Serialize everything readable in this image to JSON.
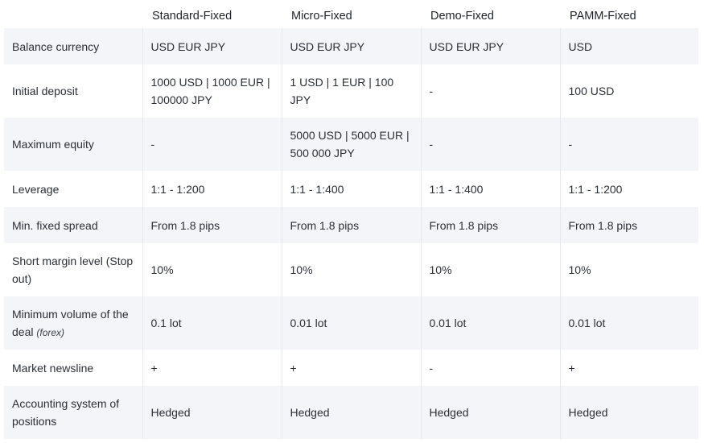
{
  "columns": [
    "",
    "Standard-Fixed",
    "Micro-Fixed",
    "Demo-Fixed",
    "PAMM-Fixed"
  ],
  "rows": [
    {
      "label": "Balance currency",
      "note": "",
      "values": [
        "USD EUR JPY",
        "USD EUR JPY",
        "USD EUR JPY",
        "USD"
      ]
    },
    {
      "label": "Initial deposit",
      "note": "",
      "values": [
        "1000 USD | 1000 EUR | 100000 JPY",
        "1 USD | 1 EUR | 100 JPY",
        "-",
        "100 USD"
      ]
    },
    {
      "label": "Maximum equity",
      "note": "",
      "values": [
        "-",
        "5000 USD | 5000 EUR | 500 000 JPY",
        "-",
        "-"
      ]
    },
    {
      "label": "Leverage",
      "note": "",
      "values": [
        "1:1 - 1:200",
        "1:1 - 1:400",
        "1:1 - 1:400",
        "1:1 - 1:200"
      ]
    },
    {
      "label": "Min. fixed spread",
      "note": "",
      "values": [
        "From 1.8 pips",
        "From 1.8 pips",
        "From 1.8 pips",
        "From 1.8 pips"
      ]
    },
    {
      "label": "Short margin level (Stop out)",
      "note": "",
      "values": [
        "10%",
        "10%",
        "10%",
        "10%"
      ]
    },
    {
      "label": "Minimum volume of the deal",
      "note": "(forex)",
      "values": [
        "0.1 lot",
        "0.01 lot",
        "0.01 lot",
        "0.01 lot"
      ]
    },
    {
      "label": "Market newsline",
      "note": "",
      "values": [
        "+",
        "+",
        "-",
        "+"
      ]
    },
    {
      "label": "Accounting system of positions",
      "note": "",
      "values": [
        "Hedged",
        "Hedged",
        "Hedged",
        "Hedged"
      ]
    }
  ],
  "colors": {
    "row_alt_bg": "#f4f5f8",
    "row_bg": "#ffffff",
    "divider": "#e6e8ec",
    "text": "#2b2f36"
  }
}
